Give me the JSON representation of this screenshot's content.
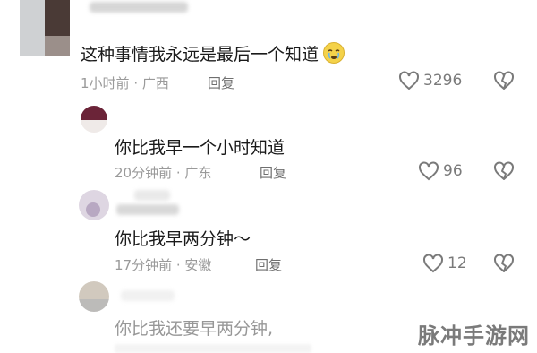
{
  "comments": [
    {
      "text": "这种事情我永远是最后一个知道",
      "time": "1小时前",
      "location": "广西",
      "reply_label": "回复",
      "likes": "3296",
      "emoji": "crying-emoji"
    },
    {
      "text": "你比我早一个小时知道",
      "time": "20分钟前",
      "location": "广东",
      "reply_label": "回复",
      "likes": "96"
    },
    {
      "text": "你比我早两分钟～",
      "time": "17分钟前",
      "location": "安徽",
      "reply_label": "回复",
      "likes": "12"
    },
    {
      "text": "你比我还要早两分钟,"
    }
  ],
  "watermark": "脉冲手游网",
  "icons": {
    "like": "heart-outline-icon",
    "dislike": "broken-heart-icon"
  },
  "colors": {
    "text": "#1a1a1a",
    "meta": "#9a9a9a",
    "reply": "#6f6f6f",
    "icon": "#7a7a7a"
  }
}
